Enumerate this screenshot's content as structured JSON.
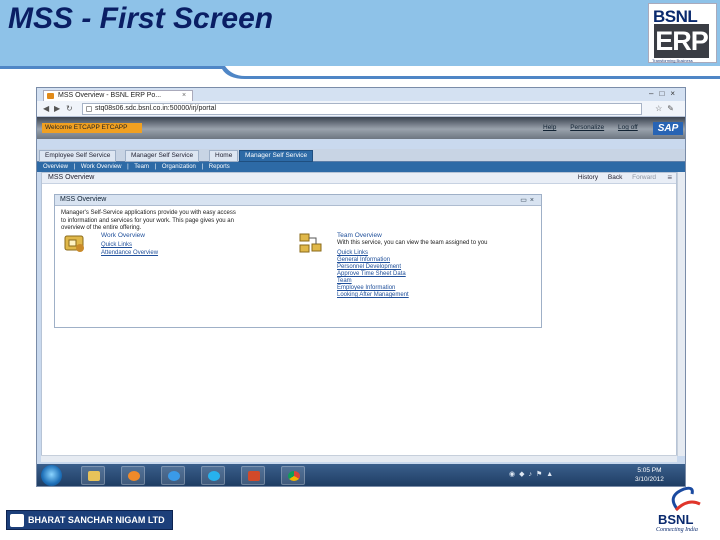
{
  "slide": {
    "title": "MSS - First Screen",
    "logo_top": {
      "brand": "BSNL",
      "product": "ERP",
      "tagline": "Transforming Business"
    },
    "logo_bottom": {
      "brand": "BSNL",
      "tagline": "Connecting India"
    },
    "company": "BHARAT SANCHAR NIGAM LTD"
  },
  "colors": {
    "header_bg": "#8ec2e8",
    "title": "#0a1e64",
    "accent_orange": "#f0a021",
    "portal_blue": "#2d6aa6"
  },
  "browser": {
    "tab_title": "MSS Overview - BSNL ERP Po...",
    "url": "stq08s06.sdc.bsnl.co.in:50000/irj/portal"
  },
  "portal": {
    "welcome": "Welcome ETCAPP ETCAPP",
    "header_links": [
      "Help",
      "Personalize",
      "Log off"
    ],
    "sap": "SAP",
    "top_tabs": [
      "Employee Self Service",
      "Manager Self Service",
      "Home",
      "Manager Self Service"
    ],
    "sub_tabs": [
      "Overview",
      "|",
      "Work Overview",
      "|",
      "Team",
      "|",
      "Organization",
      "|",
      "Reports"
    ],
    "page_title": "MSS Overview",
    "page_nav": [
      "History",
      "Back",
      "Forward"
    ],
    "iview_title": "MSS Overview",
    "intro": "Manager's Self-Service applications provide you with easy access to information and services for your work. This page gives you an overview of the entire offering.",
    "work": {
      "title": "Work Overview",
      "links": [
        "Quick Links",
        "Attendance Overview"
      ]
    },
    "team": {
      "title": "Team Overview",
      "desc": "With this service, you can view the team assigned to you",
      "links": [
        "Quick Links",
        "General Information",
        "Personnel Development",
        "Approve Time Sheet Data",
        "Team",
        "Employee Information",
        "Looking After Management"
      ]
    }
  },
  "taskbar": {
    "clock_time": "5:05 PM",
    "clock_date": "3/10/2012",
    "apps": [
      "windows-explorer",
      "media-player",
      "internet-explorer",
      "skype",
      "presentation",
      "chrome"
    ]
  }
}
